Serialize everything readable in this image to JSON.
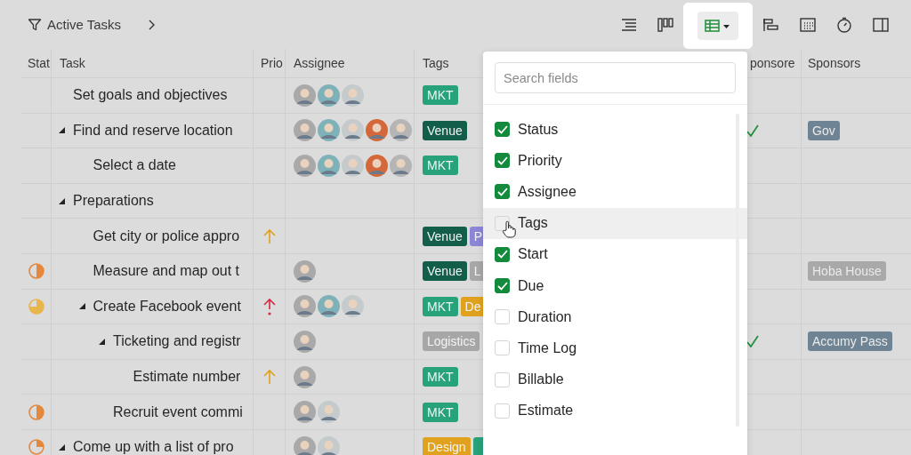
{
  "toolbar": {
    "filter_label": "Active Tasks",
    "views": [
      {
        "kind": "outline",
        "selected": false
      },
      {
        "kind": "board",
        "selected": false
      },
      {
        "kind": "table",
        "selected": true
      },
      {
        "kind": "gantt",
        "selected": false
      },
      {
        "kind": "calendar",
        "selected": false
      },
      {
        "kind": "timer",
        "selected": false
      },
      {
        "kind": "panel",
        "selected": false
      }
    ]
  },
  "table": {
    "columns": [
      "Stat",
      "Task",
      "Prio",
      "Assignee",
      "Tags",
      "ponsore",
      "Sponsors"
    ],
    "rows": [
      {
        "task": "Set goals and objectives",
        "kind": "task",
        "assignees": [
          {
            "color": "#a9a9a9"
          },
          {
            "color": "#7fb1b9"
          },
          {
            "color": "#c5cbcc"
          }
        ],
        "tags": [
          {
            "label": "MKT",
            "color": "#27a27a"
          }
        ],
        "sponsored": false
      },
      {
        "task": "Find and reserve location",
        "kind": "group",
        "expanded": true,
        "assignees": [
          {
            "color": "#a9a9a9"
          },
          {
            "color": "#7fb1b9"
          },
          {
            "color": "#c5cbcc"
          },
          {
            "color": "#d4683a"
          },
          {
            "color": "#b5b5b5"
          }
        ],
        "tags": [
          {
            "label": "Venue",
            "color": "#135e4b"
          }
        ],
        "sponsored": true,
        "sponsors": [
          {
            "label": "Gov",
            "color": "#6e8494"
          }
        ],
        "children": [
          {
            "task": "Select a date",
            "kind": "task",
            "assignees": [
              {
                "color": "#a9a9a9"
              },
              {
                "color": "#7fb1b9"
              },
              {
                "color": "#c5cbcc"
              },
              {
                "color": "#d4683a"
              },
              {
                "color": "#b5b5b5"
              }
            ],
            "tags": [
              {
                "label": "MKT",
                "color": "#27a27a"
              }
            ],
            "sponsored": false
          }
        ]
      },
      {
        "task": "Preparations",
        "kind": "group",
        "expanded": true,
        "sponsored": false,
        "children": [
          {
            "task": "Get city or police appro",
            "kind": "task",
            "priority": {
              "kind": "high"
            },
            "tags": [
              {
                "label": "Venue",
                "color": "#135e4b"
              },
              {
                "label": "P",
                "color": "#8b86d6"
              }
            ],
            "sponsored": false
          },
          {
            "task": "Measure and map out t",
            "kind": "task",
            "status": {
              "kind": "half",
              "color": "#e5883c"
            },
            "assignees": [
              {
                "color": "#a9a9a9"
              }
            ],
            "tags": [
              {
                "label": "Venue",
                "color": "#135e4b"
              },
              {
                "label": "L",
                "color": "#a7a7a7"
              }
            ],
            "sponsored": false,
            "sponsors": [
              {
                "label": "Hoba House",
                "color": "#a9a9a9"
              }
            ]
          },
          {
            "task": "Create Facebook event",
            "kind": "group",
            "expanded": true,
            "status": {
              "kind": "three_quarters",
              "color": "#e8b64c"
            },
            "priority": {
              "kind": "urgent"
            },
            "assignees": [
              {
                "color": "#a9a9a9"
              },
              {
                "color": "#7fb1b9"
              },
              {
                "color": "#c5cbcc"
              }
            ],
            "tags": [
              {
                "label": "MKT",
                "color": "#27a27a"
              },
              {
                "label": "De",
                "color": "#e0a21e"
              }
            ],
            "sponsored": false,
            "children": [
              {
                "task": "Ticketing and registr",
                "kind": "group",
                "expanded": true,
                "assignees": [
                  {
                    "color": "#a9a9a9"
                  }
                ],
                "tags": [
                  {
                    "label": "Logistics",
                    "color": "#a7a7a7"
                  }
                ],
                "sponsored": true,
                "sponsors": [
                  {
                    "label": "Accumy Pass",
                    "color": "#6e8494"
                  }
                ],
                "children": [
                  {
                    "task": "Estimate number",
                    "kind": "task",
                    "priority": {
                      "kind": "high"
                    },
                    "assignees": [
                      {
                        "color": "#a9a9a9"
                      }
                    ],
                    "tags": [
                      {
                        "label": "MKT",
                        "color": "#27a27a"
                      }
                    ],
                    "sponsored": false
                  }
                ]
              },
              {
                "task": "Recruit event commi",
                "kind": "task",
                "status": {
                  "kind": "half",
                  "color": "#e5883c"
                },
                "assignees": [
                  {
                    "color": "#a9a9a9"
                  },
                  {
                    "color": "#c5cbcc"
                  }
                ],
                "tags": [
                  {
                    "label": "MKT",
                    "color": "#27a27a"
                  }
                ],
                "sponsored": false
              }
            ]
          }
        ]
      },
      {
        "task": "Come up with a list of pro",
        "kind": "group",
        "expanded": true,
        "status": {
          "kind": "quarter",
          "color": "#e5883c"
        },
        "assignees": [
          {
            "color": "#a9a9a9"
          },
          {
            "color": "#c5cbcc"
          }
        ],
        "tags": [
          {
            "label": "Design",
            "color": "#e0a21e"
          },
          {
            "color": "#27a27a"
          }
        ],
        "sponsored": false
      }
    ]
  },
  "fields_menu": {
    "search": {
      "placeholder": "Search fields"
    },
    "fields": [
      {
        "label": "Status",
        "checked": true,
        "hovered": false
      },
      {
        "label": "Priority",
        "checked": true,
        "hovered": false
      },
      {
        "label": "Assignee",
        "checked": true,
        "hovered": false
      },
      {
        "label": "Tags",
        "checked": false,
        "hovered": true
      },
      {
        "label": "Start",
        "checked": true,
        "hovered": false
      },
      {
        "label": "Due",
        "checked": true,
        "hovered": false
      },
      {
        "label": "Duration",
        "checked": false,
        "hovered": false
      },
      {
        "label": "Time Log",
        "checked": false,
        "hovered": false
      },
      {
        "label": "Billable",
        "checked": false,
        "hovered": false
      },
      {
        "label": "Estimate",
        "checked": false,
        "hovered": false
      }
    ]
  }
}
